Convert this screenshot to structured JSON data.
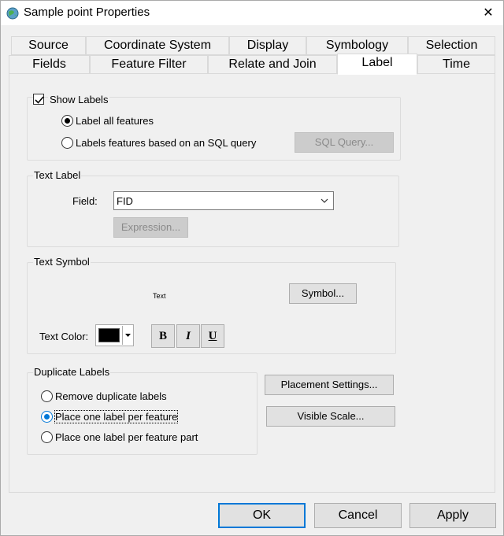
{
  "window": {
    "title": "Sample point  Properties",
    "icon": "globe-app-icon",
    "close_glyph": "✕"
  },
  "tabs": {
    "row1": [
      "Source",
      "Coordinate System",
      "Display",
      "Symbology",
      "Selection"
    ],
    "row2": [
      "Fields",
      "Feature Filter",
      "Relate and Join",
      "Label",
      "Time"
    ],
    "active": "Label"
  },
  "show_labels": {
    "label": "Show Labels",
    "checked": true,
    "option_all": "Label all features",
    "option_sql": "Labels features based on an SQL query",
    "selected": "all",
    "sql_button": "SQL Query..."
  },
  "text_label": {
    "title": "Text Label",
    "field_label": "Field:",
    "field_value": "FID",
    "expression_button": "Expression..."
  },
  "text_symbol": {
    "title": "Text Symbol",
    "preview": "Text",
    "symbol_button": "Symbol...",
    "color_label": "Text Color:",
    "color": "#000000",
    "bold": "B",
    "italic": "I",
    "underline": "U"
  },
  "duplicate_labels": {
    "title": "Duplicate Labels",
    "options": [
      "Remove duplicate labels",
      "Place one label per feature",
      "Place one label per feature part"
    ],
    "selected": "Place one label per feature"
  },
  "buttons": {
    "placement": "Placement Settings...",
    "visible_scale": "Visible Scale...",
    "ok": "OK",
    "cancel": "Cancel",
    "apply": "Apply"
  },
  "colors": {
    "accent": "#0078d7",
    "panel": "#f0f0f0"
  }
}
